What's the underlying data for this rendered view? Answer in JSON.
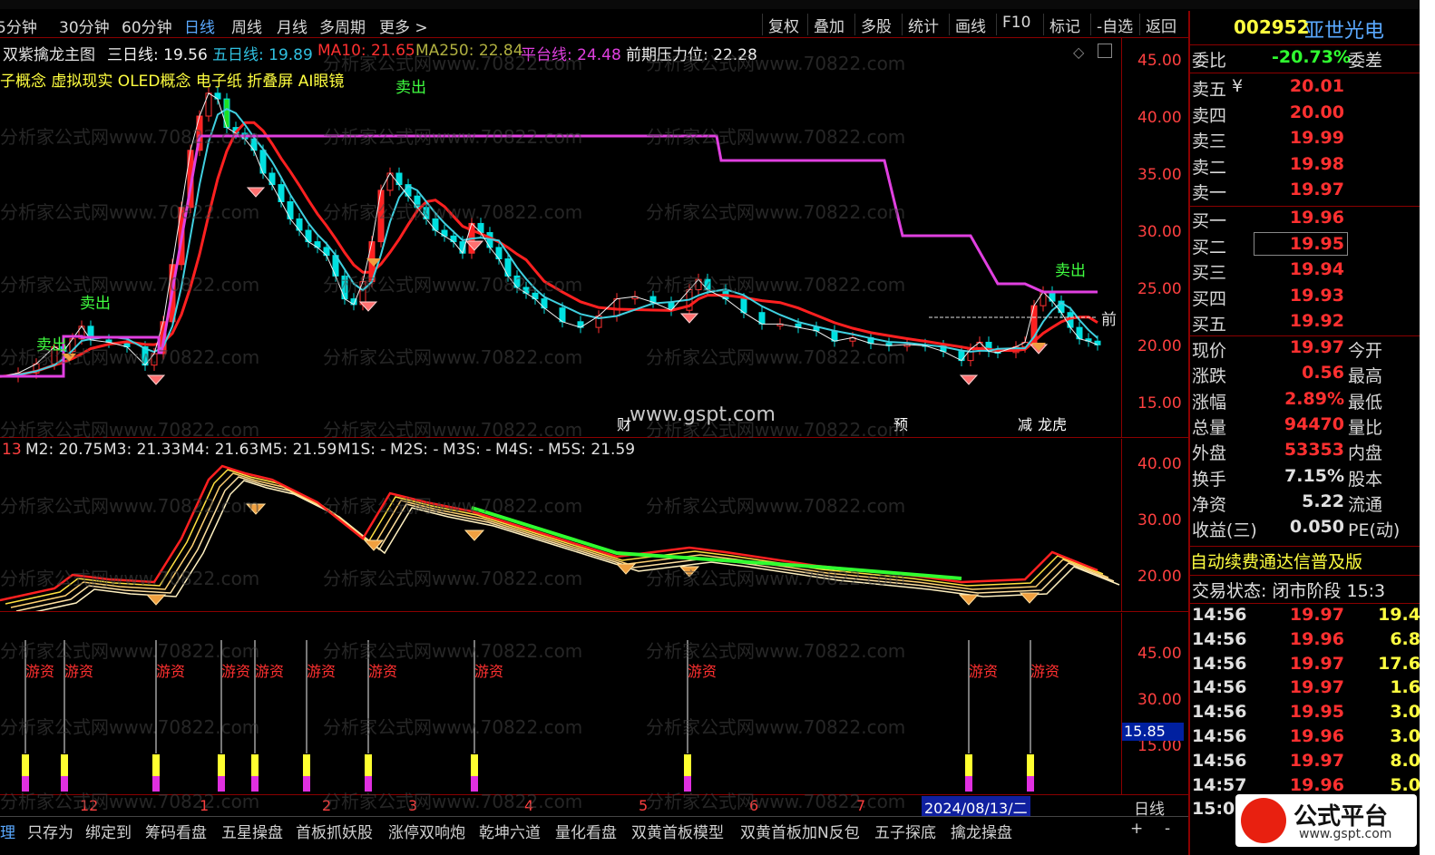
{
  "periodbar": {
    "periods": [
      "5分钟",
      "30分钟",
      "60分钟",
      "日线",
      "周线",
      "月线",
      "多周期",
      "更多 >"
    ],
    "active": "日线",
    "tools": [
      "复权",
      "叠加",
      "多股",
      "统计",
      "画线",
      "F10",
      "标记",
      "-自选",
      "返回"
    ]
  },
  "stock": {
    "code": "002952",
    "name": "亚世光电"
  },
  "main_legend": {
    "name": "双紫擒龙主图",
    "sanri": "三日线: 19.56",
    "wuri": "五日线: 19.89",
    "ma10": "MA10: 21.65",
    "ma250": "MA250: 22.84",
    "pingtai": "平台线: 24.48",
    "qianqi": "前期压力位: 22.28",
    "concepts": "子概念 虚拟现实 OLED概念 电子纸 折叠屏 AI眼镜"
  },
  "main_axis": [
    "45.00",
    "40.00",
    "35.00",
    "30.00",
    "25.00",
    "20.00",
    "15.00"
  ],
  "main_signals": {
    "sell": "卖出",
    "front": "前",
    "cai": "财",
    "yu": "预",
    "jian": "减",
    "longhu": "龙虎"
  },
  "sub1_legend": {
    "m1": "13",
    "m2": "M2: 20.75",
    "m3": "M3: 21.33",
    "m4": "M4: 21.63",
    "m5": "M5: 21.59",
    "m1s": "M1S: -",
    "m2s": "M2S: -",
    "m3s": "M3S: -",
    "m4s": "M4S: -",
    "m5s": "M5S: 21.59"
  },
  "sub1_axis": [
    "40.00",
    "30.00",
    "20.00"
  ],
  "sub2_axis": [
    "45.00",
    "30.00",
    "15.00"
  ],
  "sub2_current": "15.85",
  "sub2_label": "游资",
  "watermark": "分析家公式网www.70822.com",
  "site_watermark": "www.gspt.com",
  "datebar": {
    "labels": [
      "12",
      "1",
      "2",
      "3",
      "4",
      "5",
      "6",
      "7"
    ],
    "current_date": "2024/08/13/二",
    "period": "日线"
  },
  "bottom_tabs": [
    "理",
    "只存为",
    "绑定到",
    "筹码看盘",
    "五星操盘",
    "首板抓妖股",
    "涨停双响炮",
    "乾坤六道",
    "量化看盘",
    "双黄首板模型",
    "双黄首板加N反包",
    "五子探底",
    "擒龙操盘"
  ],
  "bottom_controls": [
    "+",
    "-"
  ],
  "panel": {
    "weibi_label": "委比",
    "weibi_value": "-20.73%",
    "weicha_label": "委差",
    "sell": [
      {
        "label": "卖五",
        "price": "20.01",
        "mark": "¥"
      },
      {
        "label": "卖四",
        "price": "20.00"
      },
      {
        "label": "卖三",
        "price": "19.99"
      },
      {
        "label": "卖二",
        "price": "19.98"
      },
      {
        "label": "卖一",
        "price": "19.97"
      }
    ],
    "buy": [
      {
        "label": "买一",
        "price": "19.96"
      },
      {
        "label": "买二",
        "price": "19.95"
      },
      {
        "label": "买三",
        "price": "19.94"
      },
      {
        "label": "买四",
        "price": "19.93"
      },
      {
        "label": "买五",
        "price": "19.92"
      }
    ],
    "stats": [
      {
        "l": "现价",
        "v": "19.97",
        "r": "今开"
      },
      {
        "l": "涨跌",
        "v": "0.56",
        "r": "最高"
      },
      {
        "l": "涨幅",
        "v": "2.89%",
        "r": "最低"
      },
      {
        "l": "总量",
        "v": "94470",
        "r": "量比"
      },
      {
        "l": "外盘",
        "v": "53353",
        "r": "内盘"
      },
      {
        "l": "换手",
        "v": "7.15%",
        "r": "股本"
      },
      {
        "l": "净资",
        "v": "5.22",
        "r": "流通"
      },
      {
        "l": "收益(三)",
        "v": "0.050",
        "r": "PE(动)"
      }
    ],
    "notice": "自动续费通达信普及版",
    "trade_state": "交易状态: 闭市阶段 15:3",
    "ticks": [
      {
        "t": "14:56",
        "p": "19.97",
        "v": "19.4"
      },
      {
        "t": "14:56",
        "p": "19.96",
        "v": "6.8"
      },
      {
        "t": "14:56",
        "p": "19.97",
        "v": "17.6"
      },
      {
        "t": "14:56",
        "p": "19.97",
        "v": "1.6"
      },
      {
        "t": "14:56",
        "p": "19.95",
        "v": "3.0"
      },
      {
        "t": "14:56",
        "p": "19.96",
        "v": "3.0"
      },
      {
        "t": "14:56",
        "p": "19.97",
        "v": "8.0"
      },
      {
        "t": "14:57",
        "p": "19.96",
        "v": "5.0"
      },
      {
        "t": "15:00",
        "p": "",
        "v": ""
      }
    ]
  },
  "logo": {
    "text": "公式平台",
    "url": "www.gspt.com"
  },
  "colors": {
    "up": "#ff3030",
    "down": "#00e0e0",
    "pingtai": "#e040e0",
    "ma": "#ff2020",
    "bg": "#000000",
    "border": "#8b0000"
  }
}
